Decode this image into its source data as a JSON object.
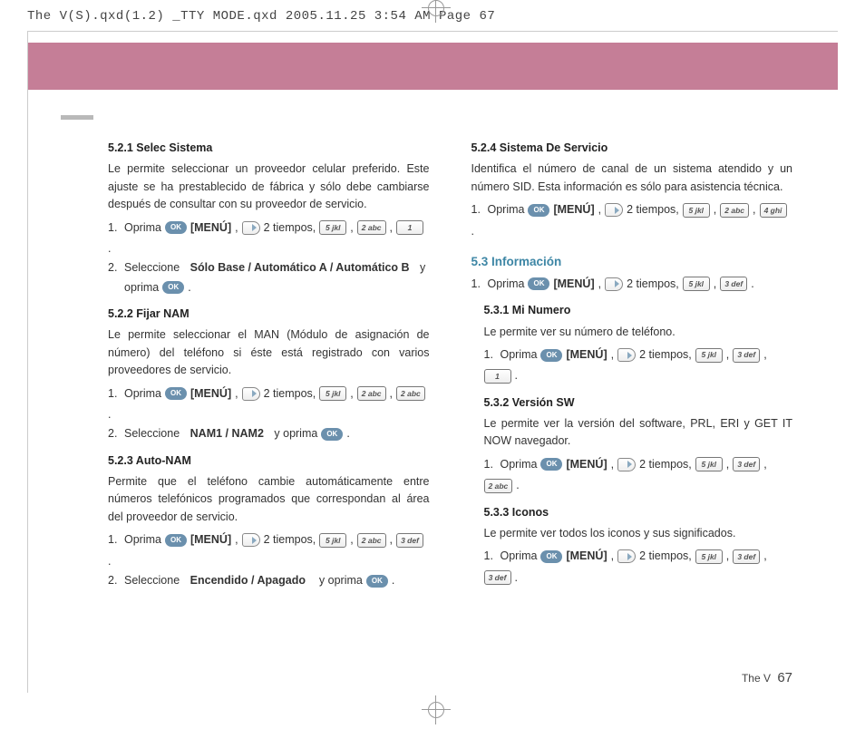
{
  "slug": "The V(S).qxd(1.2) _TTY MODE.qxd  2005.11.25  3:54 AM  Page 67",
  "footer": {
    "label": "The V",
    "page": "67"
  },
  "labels": {
    "ok": "OK",
    "menu": "[MENÚ]",
    "twotimes": "2 tiempos,",
    "oprima": "Oprima",
    "seleccione": "Seleccione",
    "yoprima": "y oprima",
    "comma_period": "."
  },
  "keys": {
    "1": "1",
    "2": "2 abc",
    "3": "3 def",
    "4": "4 ghi",
    "5": "5 jkl"
  },
  "sections": {
    "s521": {
      "title": "5.2.1 Selec Sistema",
      "body": "Le permite seleccionar un proveedor celular preferido. Este ajuste se ha prestablecido de fábrica y sólo debe cambiarse después de consultar con su proveedor de servicio.",
      "step2a": "Sólo Base / Automático A / Automático B",
      "step2b": "y"
    },
    "s522": {
      "title": "5.2.2 Fijar NAM",
      "body": "Le permite seleccionar el MAN (Módulo de asignación de número) del teléfono si éste está registrado con varios proveedores de servicio.",
      "step2": "NAM1 / NAM2"
    },
    "s523": {
      "title": "5.2.3 Auto-NAM",
      "body": "Permite que el teléfono cambie automáticamente entre números telefónicos programados que correspondan al área del proveedor de servicio.",
      "step2": "Encendido / Apagado"
    },
    "s524": {
      "title": "5.2.4 Sistema De Servicio",
      "body": "Identifica el número de canal de un sistema atendido y un número SID. Esta información es sólo para asistencia técnica."
    },
    "s53": {
      "title": "5.3 Información"
    },
    "s531": {
      "title": "5.3.1 Mi Numero",
      "body": "Le permite ver su número de teléfono."
    },
    "s532": {
      "title": "5.3.2 Versión SW",
      "body": "Le permite ver la versión del software, PRL, ERI y GET IT NOW navegador."
    },
    "s533": {
      "title": "5.3.3 Iconos",
      "body": "Le permite ver todos los iconos y sus significados."
    }
  }
}
